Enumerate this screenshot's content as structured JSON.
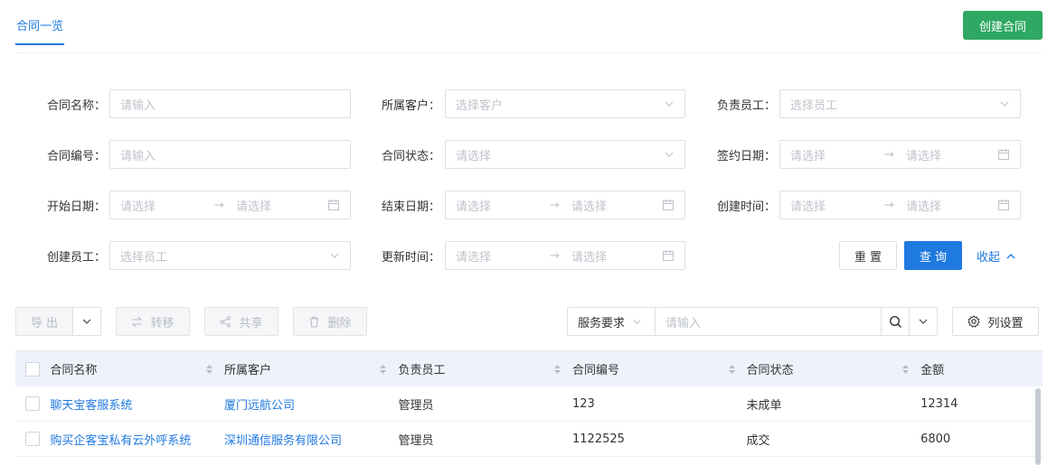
{
  "tab": {
    "label": "合同一览"
  },
  "create_button": "创建合同",
  "filters": {
    "contract_name": {
      "label": "合同名称：",
      "placeholder": "请输入"
    },
    "customer": {
      "label": "所属客户：",
      "placeholder": "选择客户"
    },
    "staff": {
      "label": "负责员工：",
      "placeholder": "选择员工"
    },
    "contract_no": {
      "label": "合同编号：",
      "placeholder": "请输入"
    },
    "status": {
      "label": "合同状态：",
      "placeholder": "请选择"
    },
    "sign_date": {
      "label": "签约日期：",
      "start": "请选择",
      "end": "请选择"
    },
    "start_date": {
      "label": "开始日期：",
      "start": "请选择",
      "end": "请选择"
    },
    "end_date": {
      "label": "结束日期：",
      "start": "请选择",
      "end": "请选择"
    },
    "create_time": {
      "label": "创建时间：",
      "start": "请选择",
      "end": "请选择"
    },
    "creator": {
      "label": "创建员工：",
      "placeholder": "选择员工"
    },
    "update_time": {
      "label": "更新时间：",
      "start": "请选择",
      "end": "请选择"
    },
    "range_arrow": "→"
  },
  "actions": {
    "reset": "重 置",
    "search": "查 询",
    "collapse": "收起"
  },
  "toolbar": {
    "export": "导 出",
    "transfer": "转移",
    "share": "共享",
    "delete": "删除",
    "search_scope": "服务要求",
    "search_placeholder": "请输入",
    "column_settings": "列设置"
  },
  "table": {
    "columns": [
      "合同名称",
      "所属客户",
      "负责员工",
      "合同编号",
      "合同状态",
      "金额"
    ],
    "rows": [
      [
        "聊天宝客服系统",
        "厦门远航公司",
        "管理员",
        "123",
        "未成单",
        "12314"
      ],
      [
        "购买企客宝私有云外呼系统",
        "深圳通信服务有限公司",
        "管理员",
        "1122525",
        "成交",
        "6800"
      ]
    ]
  },
  "colors": {
    "primary": "#1f7ae0",
    "success": "#2ea862"
  }
}
